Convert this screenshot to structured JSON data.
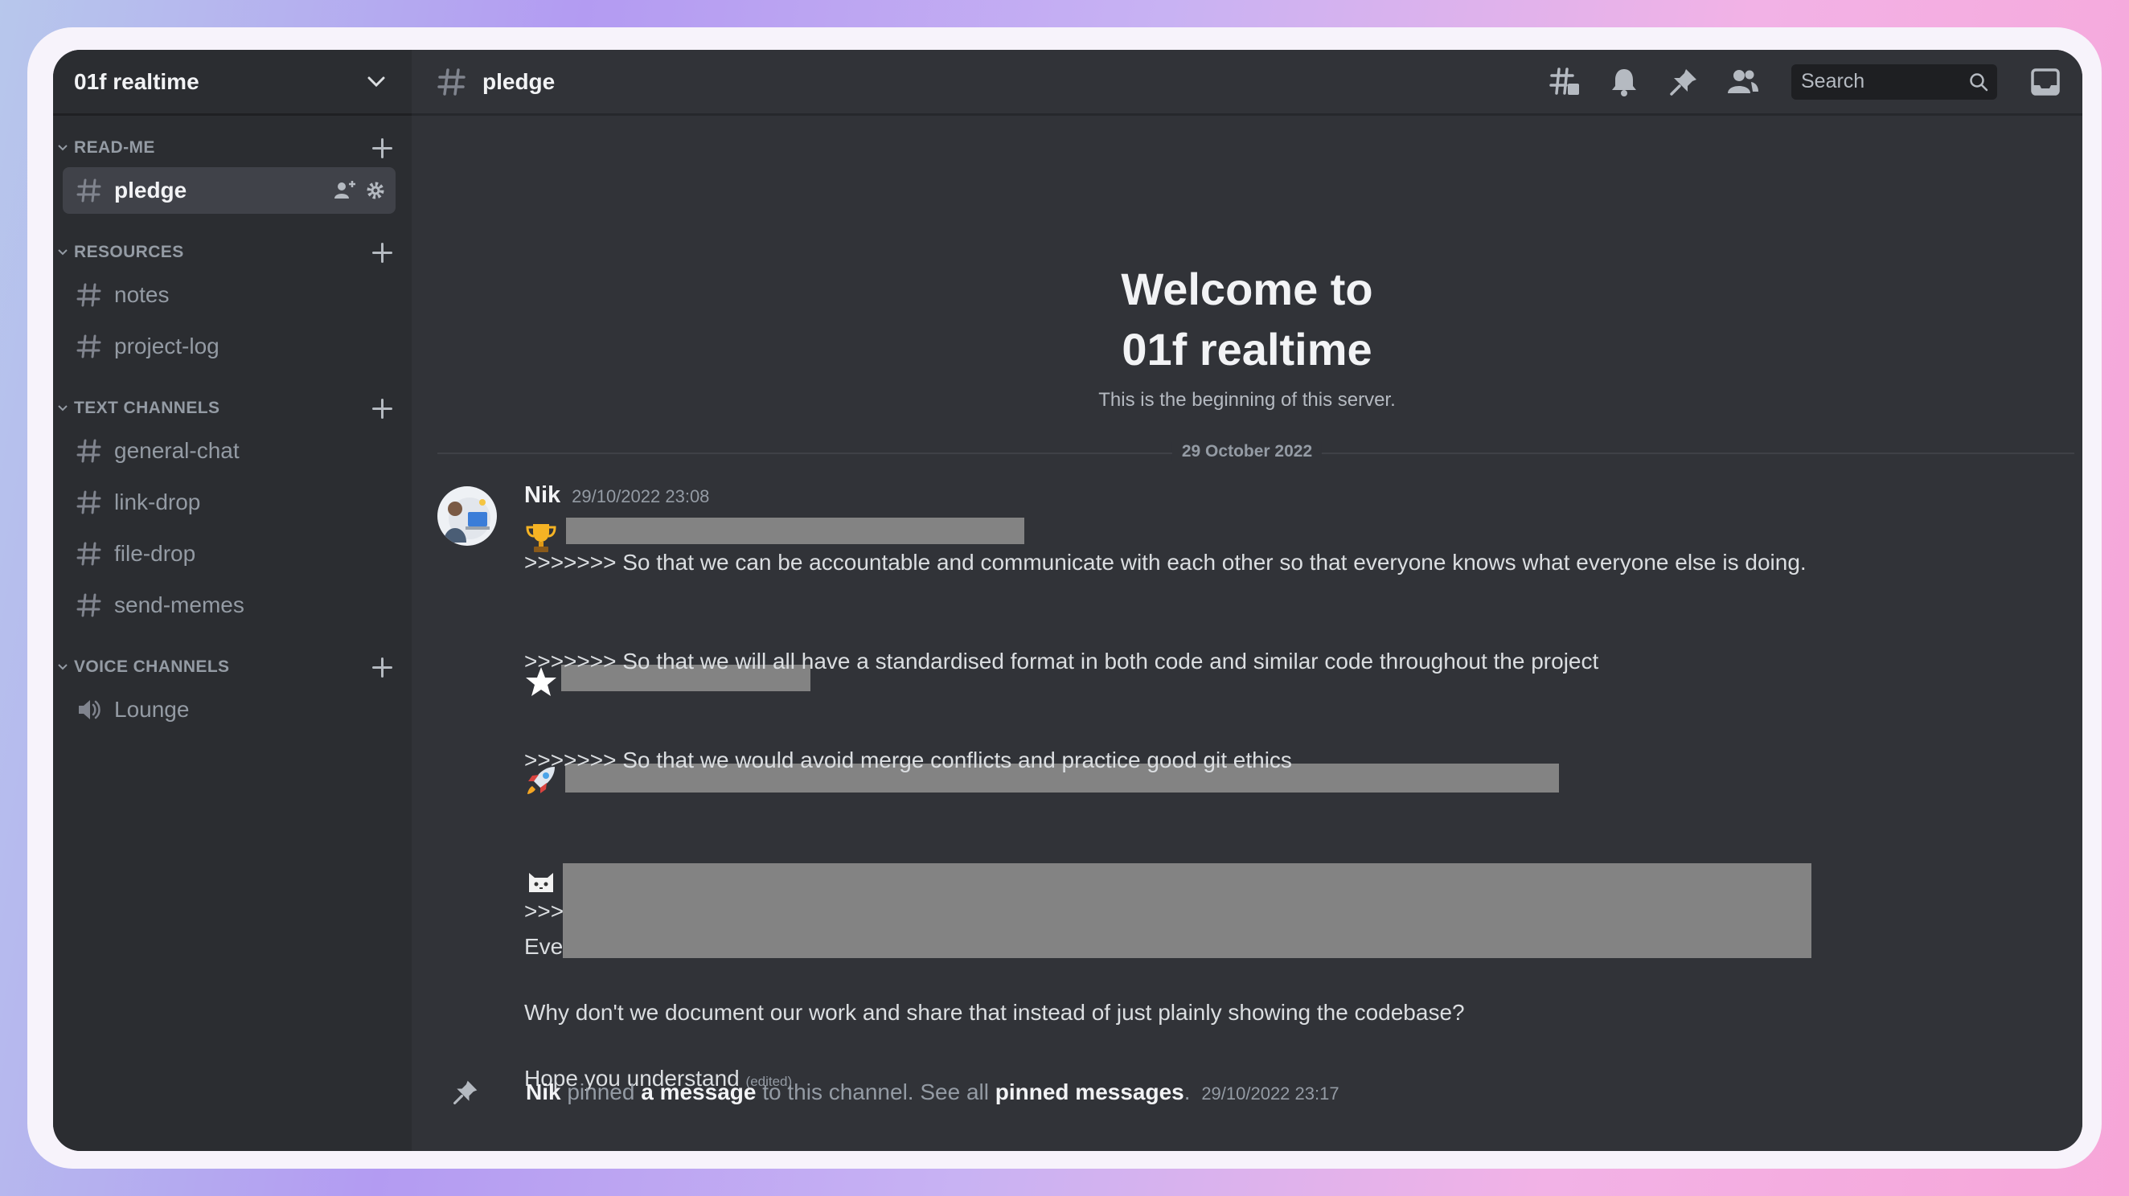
{
  "server": {
    "name": "01f realtime"
  },
  "categories": [
    {
      "label": "READ-ME",
      "channels": [
        {
          "label": "pledge",
          "active": true
        }
      ]
    },
    {
      "label": "RESOURCES",
      "channels": [
        {
          "label": "notes"
        },
        {
          "label": "project-log"
        }
      ]
    },
    {
      "label": "TEXT CHANNELS",
      "channels": [
        {
          "label": "general-chat"
        },
        {
          "label": "link-drop"
        },
        {
          "label": "file-drop"
        },
        {
          "label": "send-memes"
        }
      ]
    },
    {
      "label": "VOICE CHANNELS",
      "channels": [
        {
          "label": "Lounge",
          "voice": true
        }
      ]
    }
  ],
  "topbar": {
    "channel": "pledge",
    "search_placeholder": "Search"
  },
  "welcome": {
    "line1": "Welcome to",
    "line2": "01f realtime",
    "subtitle": "This is the beginning of this server."
  },
  "date_divider": "29 October 2022",
  "message": {
    "author": "Nik",
    "timestamp": "29/10/2022 23:08",
    "lines": [
      ">>>>>>> So that we can be accountable and communicate with each other so that everyone knows what everyone else is doing.",
      ">>>>>>> So that we will all have a standardised format in both code and similar code throughout the project",
      ">>>>>>> So that we would avoid merge conflicts and practice good git ethics",
      ">>>",
      "Eve",
      "Why don't we document our work and share that instead of just plainly showing the codebase?",
      "Hope you understand"
    ],
    "edited": "(edited)",
    "emojis": [
      "trophy-emoji",
      "star-emoji",
      "rocket-emoji",
      "cat-emoji"
    ]
  },
  "pinned": {
    "actor": "Nik",
    "text1": "pinned",
    "link1": "a message",
    "text2": "to this channel. See all",
    "link2": "pinned messages",
    "text3": ".",
    "timestamp": "29/10/2022 23:17"
  },
  "colors": {
    "sidebar": "#2b2d31",
    "main": "#313338",
    "redaction": "#838383"
  }
}
